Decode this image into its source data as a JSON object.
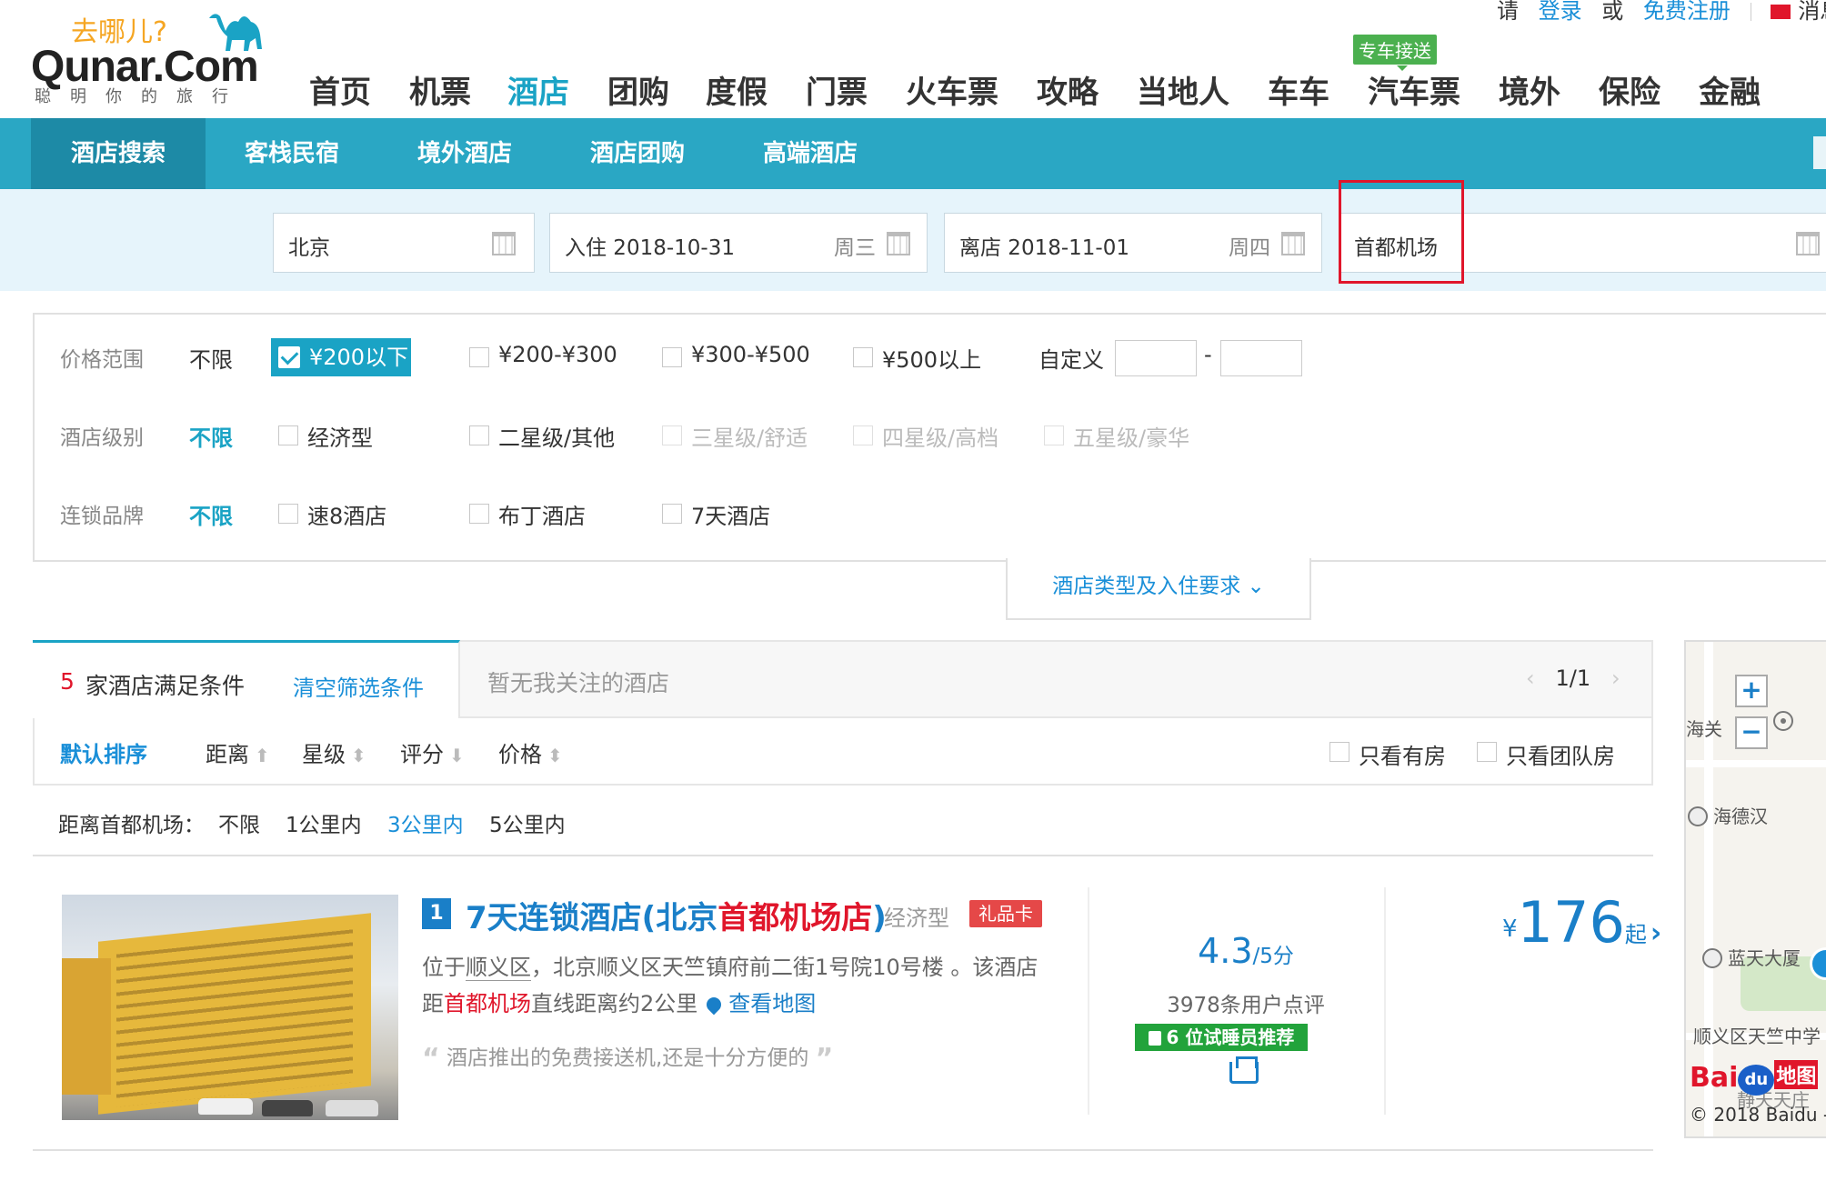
{
  "header": {
    "logo_slogan": "去哪儿?",
    "logo_text": "Qunar.Com",
    "logo_tagline": "聪明你的旅行",
    "top_links": {
      "please": "请",
      "login": "登录",
      "or": "或",
      "register": "免费注册",
      "messages": "消息"
    },
    "nav": [
      {
        "label": "首页",
        "active": false
      },
      {
        "label": "机票",
        "active": false
      },
      {
        "label": "酒店",
        "active": true
      },
      {
        "label": "团购",
        "active": false
      },
      {
        "label": "度假",
        "active": false
      },
      {
        "label": "门票",
        "active": false
      },
      {
        "label": "火车票",
        "active": false
      },
      {
        "label": "攻略",
        "active": false
      },
      {
        "label": "当地人",
        "active": false
      },
      {
        "label": "车车",
        "active": false
      },
      {
        "label": "汽车票",
        "active": false
      },
      {
        "label": "境外",
        "active": false
      },
      {
        "label": "保险",
        "active": false
      },
      {
        "label": "金融",
        "active": false
      }
    ],
    "nav_badge": "专车接送"
  },
  "sub_nav": [
    {
      "label": "酒店搜索",
      "active": true
    },
    {
      "label": "客栈民宿",
      "active": false
    },
    {
      "label": "境外酒店",
      "active": false
    },
    {
      "label": "酒店团购",
      "active": false
    },
    {
      "label": "高端酒店",
      "active": false
    }
  ],
  "search": {
    "city": "北京",
    "checkin_label": "入住 2018-10-31",
    "checkin_weekday": "周三",
    "checkout_label": "离店 2018-11-01",
    "checkout_weekday": "周四",
    "keyword": "首都机场"
  },
  "filters": {
    "price": {
      "label": "价格范围",
      "any": "不限",
      "selected": "¥200以下",
      "options": [
        "¥200-¥300",
        "¥300-¥500",
        "¥500以上"
      ],
      "custom_label": "自定义",
      "custom_dash": "-"
    },
    "level": {
      "label": "酒店级别",
      "any": "不限",
      "options": [
        "经济型",
        "二星级/其他",
        "三星级/舒适",
        "四星级/高档",
        "五星级/豪华"
      ]
    },
    "brand": {
      "label": "连锁品牌",
      "any": "不限",
      "options": [
        "速8酒店",
        "布丁酒店",
        "7天酒店"
      ]
    },
    "more_toggle": "酒店类型及入住要求"
  },
  "results": {
    "count": "5",
    "count_text": "家酒店满足条件",
    "clear_filters": "清空筛选条件",
    "followed_tab": "暂无我关注的酒店",
    "pager": "1/1",
    "sort": [
      {
        "label": "默认排序",
        "active": true,
        "arrow": ""
      },
      {
        "label": "距离",
        "active": false,
        "arrow": "⬆"
      },
      {
        "label": "星级",
        "active": false,
        "arrow": "⬍"
      },
      {
        "label": "评分",
        "active": false,
        "arrow": "⬇"
      },
      {
        "label": "价格",
        "active": false,
        "arrow": "⬍"
      }
    ],
    "only_available": "只看有房",
    "only_group": "只看团队房",
    "distance": {
      "label": "距离首都机场：",
      "options": [
        {
          "label": "不限",
          "active": false
        },
        {
          "label": "1公里内",
          "active": false
        },
        {
          "label": "3公里内",
          "active": true
        },
        {
          "label": "5公里内",
          "active": false
        }
      ]
    }
  },
  "hotel": {
    "rank": "1",
    "name_pre": "7天连锁酒店(北京",
    "name_hl": "首都机场店",
    "name_post": ")",
    "type": "经济型",
    "gift": "礼品卡",
    "addr_1": "位于",
    "addr_district": "顺义区",
    "addr_2": "，北京顺义区天竺镇府前二街1号院10号楼 。该酒店",
    "addr_3": "距",
    "addr_hl": "首都机场",
    "addr_4": "直线距离约2公里",
    "map_link": "查看地图",
    "review": "酒店推出的免费接送机,还是十分方便的",
    "score": "4.3",
    "score_max": "/5分",
    "review_count": "3978条用户点评",
    "trial": "6 位试睡员推荐",
    "currency": "¥",
    "price": "176",
    "price_suffix": "起",
    "price_arrow": "›"
  },
  "map": {
    "zoom_in": "+",
    "zoom_out": "−",
    "label_1": "海关",
    "label_2": "海德汉",
    "label_3": "蓝天大厦",
    "label_4": "顺义区天竺中学",
    "label_5": "静天天庄",
    "baidu_bai": "Bai",
    "baidu_du": "du",
    "baidu_map": "地图",
    "copyright": "© 2018 Baidu -"
  }
}
